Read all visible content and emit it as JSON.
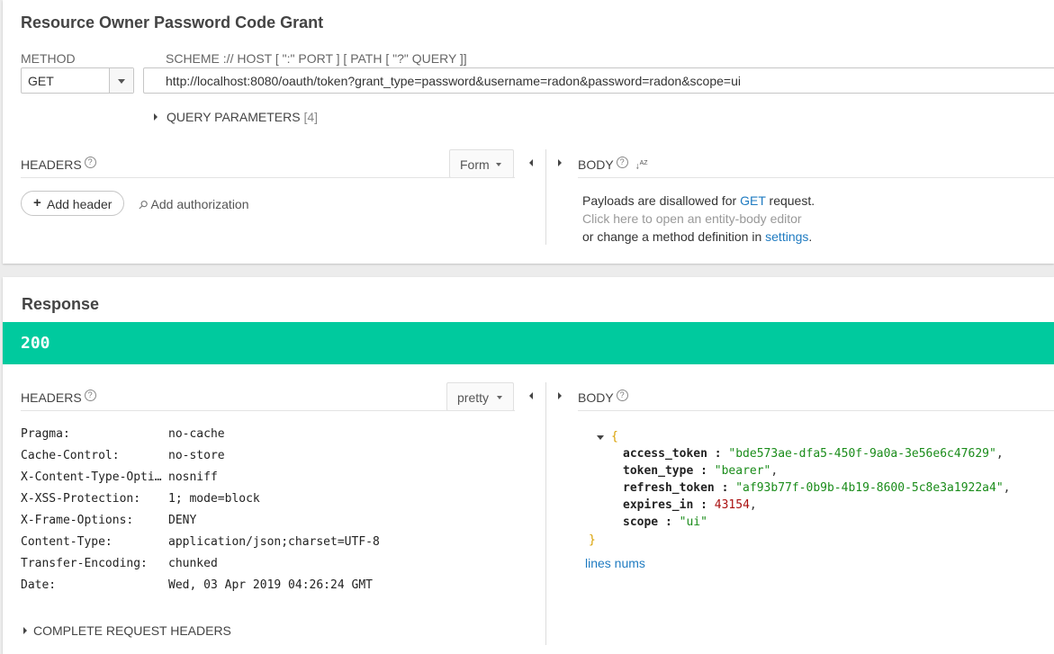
{
  "request": {
    "title": "Resource Owner Password Code Grant",
    "method_label": "METHOD",
    "method_value": "GET",
    "url_label": "SCHEME :// HOST [ \":\" PORT ] [ PATH [ \"?\" QUERY ]]",
    "url_value": "http://localhost:8080/oauth/token?grant_type=password&username=radon&password=radon&scope=ui",
    "query_params_label": "QUERY PARAMETERS",
    "query_params_count": "[4]",
    "headers_label": "HEADERS",
    "headers_mode": "Form",
    "add_header_label": "Add header",
    "add_auth_label": "Add authorization",
    "body_label": "BODY",
    "payload_line1_pre": "Payloads are disallowed for ",
    "payload_line1_link": "GET",
    "payload_line1_post": " request.",
    "payload_line2": "Click here to open an entity-body editor",
    "payload_line3_pre": "or change a method definition in ",
    "payload_line3_link": "settings",
    "payload_line3_post": "."
  },
  "response": {
    "title": "Response",
    "status_code": "200",
    "status_color": "#00ca9e",
    "headers_label": "HEADERS",
    "headers_mode": "pretty",
    "body_label": "BODY",
    "headers": [
      {
        "name": "Pragma:",
        "value": "no-cache"
      },
      {
        "name": "Cache-Control:",
        "value": "no-store"
      },
      {
        "name": "X-Content-Type-Options:",
        "value": "nosniff"
      },
      {
        "name": "X-XSS-Protection:",
        "value": "1; mode=block"
      },
      {
        "name": "X-Frame-Options:",
        "value": "DENY"
      },
      {
        "name": "Content-Type:",
        "value": "application/json;charset=UTF-8"
      },
      {
        "name": "Transfer-Encoding:",
        "value": "chunked"
      },
      {
        "name": "Date:",
        "value": "Wed, 03 Apr 2019 04:26:24 GMT"
      }
    ],
    "complete_request_headers_label": "COMPLETE REQUEST HEADERS",
    "body_json": [
      {
        "key": "access_token",
        "value": "\"bde573ae-dfa5-450f-9a0a-3e56e6c47629\"",
        "type": "string",
        "comma": ","
      },
      {
        "key": "token_type",
        "value": "\"bearer\"",
        "type": "string",
        "comma": ","
      },
      {
        "key": "refresh_token",
        "value": "\"af93b77f-0b9b-4b19-8600-5c8e3a1922a4\"",
        "type": "string",
        "comma": ","
      },
      {
        "key": "expires_in",
        "value": "43154",
        "type": "number",
        "comma": ","
      },
      {
        "key": "scope",
        "value": "\"ui\"",
        "type": "string",
        "comma": ""
      }
    ],
    "open_brace": "{",
    "close_brace": "}",
    "lines_nums_label": "lines nums"
  },
  "colors": {
    "link": "#1f7bc1",
    "json_string": "#1a8c1a",
    "json_number": "#a11",
    "json_brace": "#d9a000"
  }
}
